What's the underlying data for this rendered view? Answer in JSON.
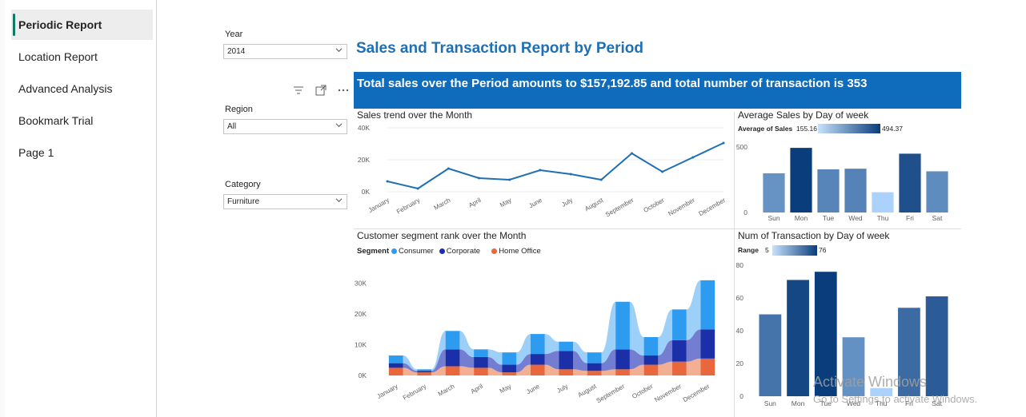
{
  "nav": {
    "items": [
      {
        "label": "Periodic Report",
        "active": true
      },
      {
        "label": "Location Report",
        "active": false
      },
      {
        "label": "Advanced Analysis",
        "active": false
      },
      {
        "label": "Bookmark Trial",
        "active": false
      },
      {
        "label": "Page 1",
        "active": false
      }
    ]
  },
  "slicers": {
    "year": {
      "label": "Year",
      "value": "2014"
    },
    "region": {
      "label": "Region",
      "value": "All"
    },
    "category": {
      "label": "Category",
      "value": "Furniture"
    }
  },
  "toolbar_icons": [
    "filter-icon",
    "focus-mode-icon",
    "more-options-icon"
  ],
  "report": {
    "title": "Sales and Transaction Report by Period",
    "summary": "Total sales over the Period amounts to $157,192.85 and total number of transaction is 353"
  },
  "colors": {
    "accent": "#117865",
    "banner": "#0f6cbd",
    "line": "#1f6fb5",
    "consumer": "#2d9bf0",
    "corporate": "#1a2fa8",
    "home_office": "#e8673c"
  },
  "months": [
    "January",
    "February",
    "March",
    "April",
    "May",
    "June",
    "July",
    "August",
    "September",
    "October",
    "November",
    "December"
  ],
  "chart_data": [
    {
      "type": "line",
      "title": "Sales trend over the Month",
      "categories": [
        "January",
        "February",
        "March",
        "April",
        "May",
        "June",
        "July",
        "August",
        "September",
        "October",
        "November",
        "December"
      ],
      "values": [
        6500,
        2000,
        14500,
        8500,
        7500,
        13500,
        11000,
        7500,
        24000,
        12500,
        21500,
        30500
      ],
      "yticks": [
        "0K",
        "20K",
        "40K"
      ],
      "ylim": [
        0,
        40000
      ]
    },
    {
      "type": "bar",
      "title": "Average Sales by Day of week",
      "legend_label": "Average of Sales",
      "legend_min": "155.16",
      "legend_max": "494.37",
      "categories": [
        "Sun",
        "Mon",
        "Tue",
        "Wed",
        "Thu",
        "Fri",
        "Sat"
      ],
      "values": [
        300,
        494.37,
        330,
        335,
        155.16,
        450,
        315
      ],
      "yticks": [
        "0",
        "500"
      ],
      "ylim": [
        0,
        550
      ]
    },
    {
      "type": "area",
      "title": "Customer segment rank over the Month",
      "legend_title": "Segment",
      "categories": [
        "January",
        "February",
        "March",
        "April",
        "May",
        "June",
        "July",
        "August",
        "September",
        "October",
        "November",
        "December"
      ],
      "series": [
        {
          "name": "Consumer",
          "values": [
            2500,
            500,
            6000,
            2500,
            4000,
            6500,
            3000,
            3500,
            15500,
            6000,
            10000,
            16000
          ]
        },
        {
          "name": "Corporate",
          "values": [
            1500,
            500,
            5500,
            3500,
            2500,
            3500,
            6000,
            2500,
            6500,
            3000,
            7000,
            9500
          ]
        },
        {
          "name": "Home Office",
          "values": [
            2500,
            1000,
            3000,
            2500,
            1000,
            3500,
            2000,
            1500,
            2000,
            3500,
            4500,
            5500
          ]
        }
      ],
      "yticks": [
        "0K",
        "10K",
        "20K",
        "30K"
      ],
      "ylim": [
        0,
        32000
      ]
    },
    {
      "type": "bar",
      "title": "Num of Transaction by Day of week",
      "legend_label": "Range",
      "legend_min": "5",
      "legend_max": "76",
      "categories": [
        "Sun",
        "Mon",
        "Tue",
        "Wed",
        "Thu",
        "Fri",
        "Sat"
      ],
      "values": [
        50,
        71,
        76,
        36,
        5,
        54,
        61
      ],
      "yticks": [
        "0",
        "20",
        "40",
        "60",
        "80"
      ],
      "ylim": [
        0,
        80
      ]
    }
  ],
  "watermark": {
    "line1": "Activate Windows",
    "line2": "Go to Settings to activate Windows."
  }
}
